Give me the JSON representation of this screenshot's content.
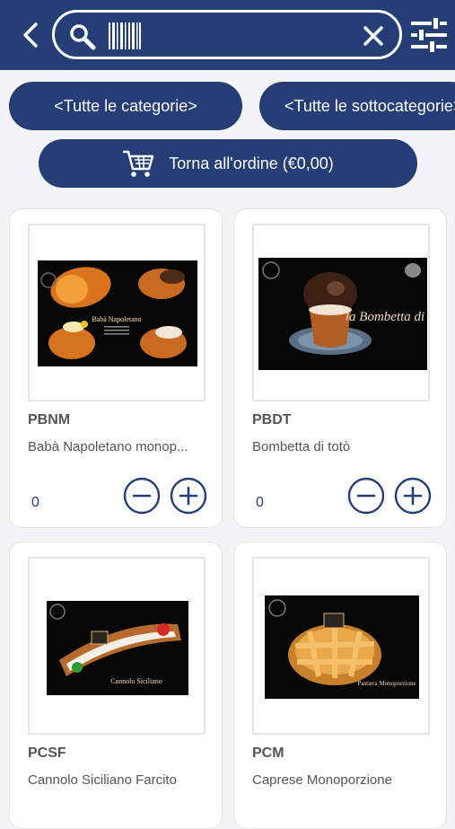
{
  "search": {
    "value": "",
    "placeholder": ""
  },
  "categories": {
    "all_categories_label": "<Tutte le categorie>",
    "all_subcategories_label": "<Tutte le sottocategorie>"
  },
  "order_button": {
    "label": "Torna all'ordine (€0,00)"
  },
  "products": [
    {
      "code": "PBNM",
      "name": "Babà Napoletano monop...",
      "quantity": "0",
      "image_caption": "Babà Napoletano"
    },
    {
      "code": "PBDT",
      "name": "Bombetta di totò",
      "quantity": "0",
      "image_caption": "la Bombetta di Totò"
    },
    {
      "code": "PCSF",
      "name": "Cannolo Siciliano Farcito",
      "image_caption": "Cannolo Siciliano"
    },
    {
      "code": "PCM",
      "name": "Caprese Monoporzione",
      "image_caption": "Pastiera Monoporzione"
    }
  ],
  "colors": {
    "primary": "#253e75",
    "background": "#f4f4f6",
    "card": "#ffffff"
  },
  "icons": [
    "back-arrow-icon",
    "search-icon",
    "barcode-icon",
    "close-icon",
    "filter-sliders-icon",
    "cart-icon",
    "minus-icon",
    "plus-icon"
  ]
}
